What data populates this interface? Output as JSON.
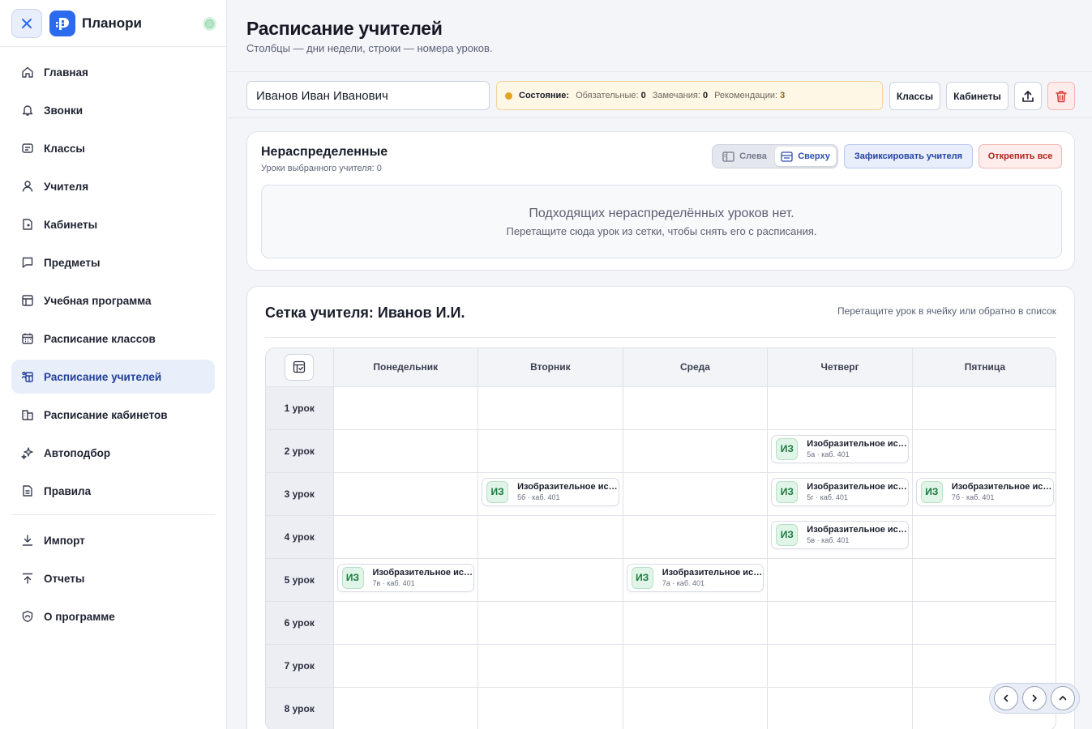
{
  "app": {
    "name": "Планори",
    "accent": "#2c6bed"
  },
  "sidebar": {
    "items": [
      {
        "label": "Главная",
        "icon": "home-icon"
      },
      {
        "label": "Звонки",
        "icon": "bell-icon"
      },
      {
        "label": "Классы",
        "icon": "classes-icon"
      },
      {
        "label": "Учителя",
        "icon": "user-icon"
      },
      {
        "label": "Кабинеты",
        "icon": "door-icon"
      },
      {
        "label": "Предметы",
        "icon": "message-icon"
      },
      {
        "label": "Учебная программа",
        "icon": "table-icon"
      },
      {
        "label": "Расписание классов",
        "icon": "calendar-icon"
      },
      {
        "label": "Расписание учителей",
        "icon": "teacher-schedule-icon",
        "active": true
      },
      {
        "label": "Расписание кабинетов",
        "icon": "building-icon"
      },
      {
        "label": "Автоподбор",
        "icon": "sparkles-icon"
      },
      {
        "label": "Правила",
        "icon": "document-icon"
      }
    ],
    "bottom_items": [
      {
        "label": "Импорт",
        "icon": "download-icon"
      },
      {
        "label": "Отчеты",
        "icon": "upload-icon"
      },
      {
        "label": "О программе",
        "icon": "shield-icon"
      }
    ]
  },
  "header": {
    "title": "Расписание учителей",
    "subtitle": "Столбцы — дни недели, строки — номера уроков."
  },
  "toolbar": {
    "teacher_value": "Иванов Иван Иванович",
    "state_label": "Состояние:",
    "required_label": "Обязательные:",
    "required_count": "0",
    "remarks_label": "Замечания:",
    "remarks_count": "0",
    "recommendations_label": "Рекомендации:",
    "recommendations_count": "3",
    "classes_button": "Классы",
    "rooms_button": "Кабинеты",
    "state_color": "#e3a41d"
  },
  "unassigned": {
    "title": "Нераспределенные",
    "subtitle": "Уроки выбранного учителя: 0",
    "toggle_left": "Слева",
    "toggle_top": "Сверху",
    "toggle_selected": "Сверху",
    "fix_button": "Зафиксировать учителя",
    "unpin_button": "Открепить все",
    "empty_title": "Подходящих нераспределённых уроков нет.",
    "empty_hint": "Перетащите сюда урок из сетки, чтобы снять его с расписания."
  },
  "grid": {
    "title": "Сетка учителя: Иванов И.И.",
    "hint": "Перетащите урок в ячейку или обратно в список",
    "days": [
      "Понедельник",
      "Вторник",
      "Среда",
      "Четверг",
      "Пятница"
    ],
    "rows": [
      {
        "label": "1 урок",
        "cells": [
          null,
          null,
          null,
          null,
          null
        ]
      },
      {
        "label": "2 урок",
        "cells": [
          null,
          null,
          null,
          {
            "badge": "ИЗ",
            "name": "Изобразительное искусство",
            "meta": "5а · каб. 401"
          },
          null
        ]
      },
      {
        "label": "3 урок",
        "cells": [
          null,
          {
            "badge": "ИЗ",
            "name": "Изобразительное искусство",
            "meta": "5б · каб. 401"
          },
          null,
          {
            "badge": "ИЗ",
            "name": "Изобразительное искусство",
            "meta": "5г · каб. 401"
          },
          {
            "badge": "ИЗ",
            "name": "Изобразительное искусство",
            "meta": "7б · каб. 401"
          }
        ]
      },
      {
        "label": "4 урок",
        "cells": [
          null,
          null,
          null,
          {
            "badge": "ИЗ",
            "name": "Изобразительное искусство",
            "meta": "5в · каб. 401"
          },
          null
        ]
      },
      {
        "label": "5 урок",
        "cells": [
          {
            "badge": "ИЗ",
            "name": "Изобразительное искусство",
            "meta": "7в · каб. 401"
          },
          null,
          {
            "badge": "ИЗ",
            "name": "Изобразительное искусство",
            "meta": "7а · каб. 401"
          },
          null,
          null
        ]
      },
      {
        "label": "6 урок",
        "cells": [
          null,
          null,
          null,
          null,
          null
        ]
      },
      {
        "label": "7 урок",
        "cells": [
          null,
          null,
          null,
          null,
          null
        ]
      },
      {
        "label": "8 урок",
        "cells": [
          null,
          null,
          null,
          null,
          null
        ]
      }
    ]
  }
}
